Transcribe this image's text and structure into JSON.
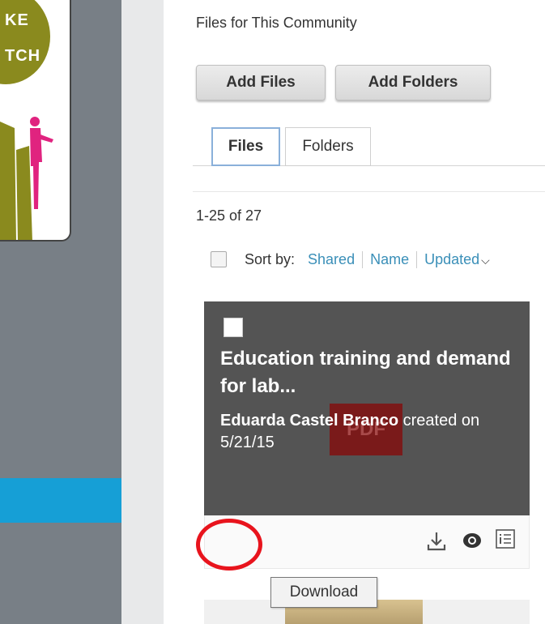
{
  "sidebar": {
    "logo_lines": [
      "KE",
      "TCH"
    ]
  },
  "main": {
    "section_title": "Files for This Community",
    "buttons": {
      "add_files": "Add Files",
      "add_folders": "Add Folders"
    },
    "tabs": [
      {
        "label": "Files",
        "selected": true
      },
      {
        "label": "Folders",
        "selected": false
      }
    ],
    "count_text": "1-25 of 27",
    "sort": {
      "label": "Sort by:",
      "options": [
        "Shared",
        "Name",
        "Updated"
      ],
      "active": "Updated"
    },
    "file_card": {
      "title": "Education training and demand for lab...",
      "thumbnail_badge": "PDF",
      "author": "Eduarda Castel Branco",
      "created_text": " created on 5/21/15",
      "actions": [
        "download-icon",
        "preview-icon",
        "details-icon"
      ]
    },
    "tooltip": "Download"
  },
  "colors": {
    "sidebar": "#787f86",
    "sidebar_band": "#169fd6",
    "card_thumb": "#545454",
    "link": "#3a8fb8",
    "highlight_circle": "#e8141d"
  }
}
